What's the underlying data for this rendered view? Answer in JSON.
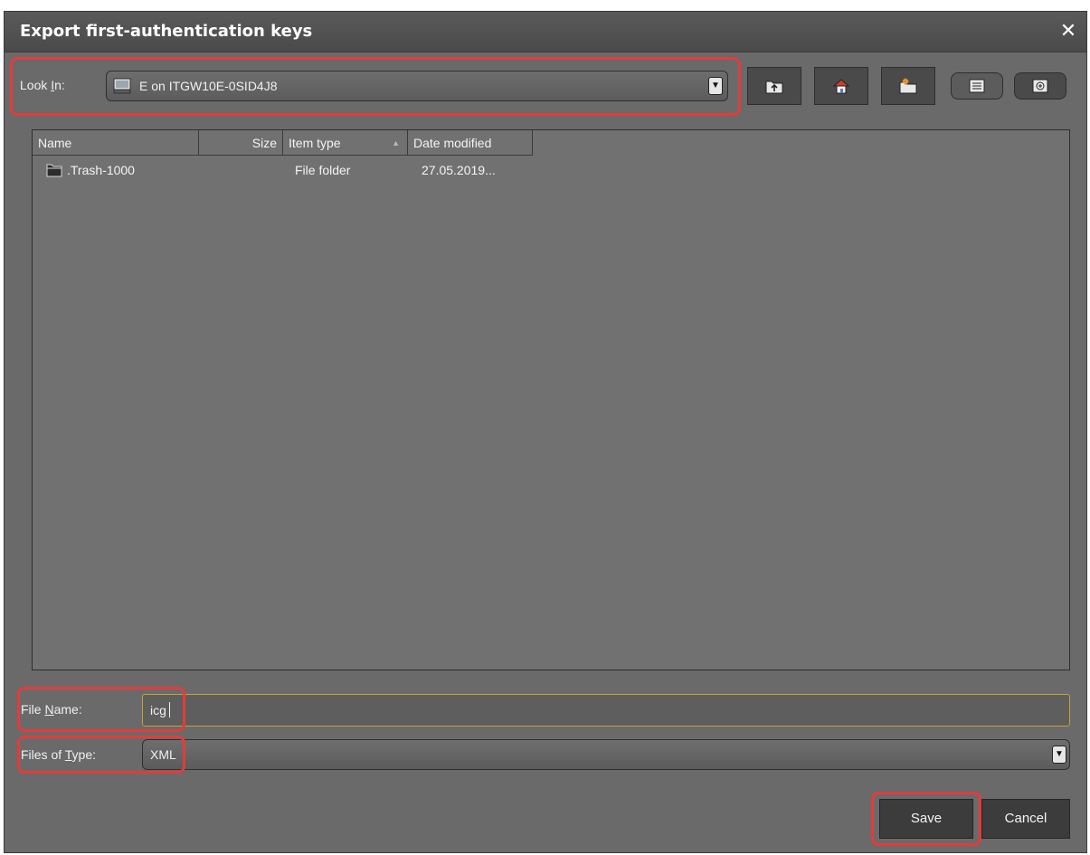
{
  "dialog": {
    "title": "Export first-authentication keys",
    "close_glyph": "✕"
  },
  "look_in": {
    "label_prefix": "Look ",
    "label_mnemonic": "I",
    "label_suffix": "n:",
    "value": "E on ITGW10E-0SID4J8",
    "icon": "drive-icon",
    "dropdown_glyph": "▼"
  },
  "toolbar": [
    {
      "name": "up-one-level-button",
      "icon": "folder-up-icon"
    },
    {
      "name": "home-button",
      "icon": "home-icon"
    },
    {
      "name": "new-folder-button",
      "icon": "new-folder-icon"
    },
    {
      "name": "list-view-button",
      "icon": "list-icon"
    },
    {
      "name": "details-view-button",
      "icon": "details-icon"
    }
  ],
  "files": {
    "columns": [
      "Name",
      "Size",
      "Item type",
      "Date modified"
    ],
    "sort_glyph": "▲",
    "rows": [
      {
        "name": ".Trash-1000",
        "size": "",
        "type": "File folder",
        "date": "27.05.2019...",
        "icon": "folder-icon"
      }
    ]
  },
  "file_name": {
    "label_prefix": "File ",
    "label_mnemonic": "N",
    "label_suffix": "ame:",
    "value": "icg"
  },
  "file_type": {
    "label_prefix": "Files of ",
    "label_mnemonic": "T",
    "label_suffix": "ype:",
    "value": "XML",
    "dropdown_glyph": "▼"
  },
  "buttons": {
    "save": "Save",
    "cancel": "Cancel"
  },
  "colors": {
    "highlight": "#e23c3c",
    "focus_border": "#c4a23c",
    "dialog_bg": "#6a6a6a"
  }
}
